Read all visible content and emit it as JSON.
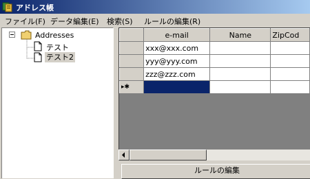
{
  "window": {
    "title": "アドレス帳"
  },
  "menu": {
    "items": [
      "ファイル(F)",
      "データ編集(E)",
      "検索(S)",
      "ルールの編集(R)"
    ]
  },
  "tree": {
    "root_toggle": "⊟",
    "root_label": "Addresses",
    "children": [
      {
        "label": "テスト",
        "selected": false
      },
      {
        "label": "テスト2",
        "selected": true
      }
    ]
  },
  "grid": {
    "columns": [
      "e-mail",
      "Name",
      "ZipCod"
    ],
    "rows": [
      [
        "xxx@xxx.com",
        "",
        ""
      ],
      [
        "yyy@yyy.com",
        "",
        ""
      ],
      [
        "zzz@zzz.com",
        "",
        ""
      ]
    ],
    "new_row_marker": "▸✱"
  },
  "buttons": {
    "rule_edit": "ルールの編集"
  },
  "colors": {
    "title_start": "#0a246a",
    "title_end": "#a6caf0",
    "selection": "#0a246a",
    "face": "#d4d0c8"
  }
}
